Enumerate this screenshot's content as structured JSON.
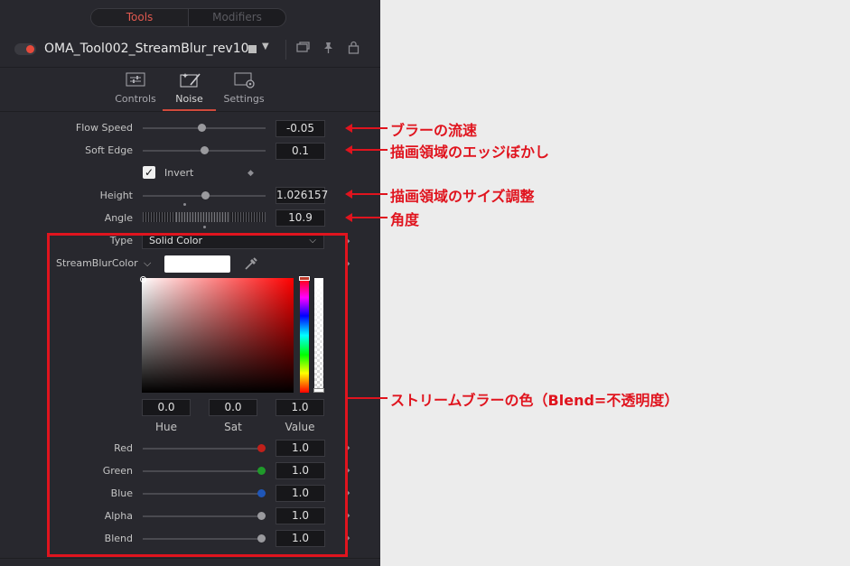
{
  "switcher": {
    "tools": "Tools",
    "modifiers": "Modifiers"
  },
  "header": {
    "tool_name": "OMA_Tool002_StreamBlur_rev10"
  },
  "tabs": [
    {
      "label": "Controls",
      "icon": "sliders-icon"
    },
    {
      "label": "Noise",
      "icon": "wand-icon"
    },
    {
      "label": "Settings",
      "icon": "gear-icon"
    }
  ],
  "params": {
    "flow_speed": {
      "label": "Flow Speed",
      "value": "-0.05"
    },
    "soft_edge": {
      "label": "Soft Edge",
      "value": "0.1"
    },
    "invert": {
      "label": "Invert",
      "checked": true
    },
    "height": {
      "label": "Height",
      "value": "1.026157"
    },
    "angle": {
      "label": "Angle",
      "value": "10.9"
    },
    "type": {
      "label": "Type",
      "value": "Solid Color"
    },
    "color_label": "StreamBlurColor"
  },
  "hsv": {
    "hue": {
      "label": "Hue",
      "value": "0.0"
    },
    "sat": {
      "label": "Sat",
      "value": "0.0"
    },
    "val": {
      "label": "Value",
      "value": "1.0"
    }
  },
  "channels": {
    "red": {
      "label": "Red",
      "value": "1.0",
      "color": "#c0201a"
    },
    "green": {
      "label": "Green",
      "value": "1.0",
      "color": "#1f9a2a"
    },
    "blue": {
      "label": "Blue",
      "value": "1.0",
      "color": "#1f56b8"
    },
    "alpha": {
      "label": "Alpha",
      "value": "1.0",
      "color": "#9a9a9e"
    },
    "blend": {
      "label": "Blend",
      "value": "1.0",
      "color": "#9a9a9e"
    }
  },
  "annotations": {
    "flow_speed": "ブラーの流速",
    "soft_edge": "描画領域のエッジぼかし",
    "height": "描画領域のサイズ調整",
    "angle": "角度",
    "color": "ストリームブラーの色（Blend=不透明度）"
  },
  "colors": {
    "accent": "#d04a3c",
    "annotation": "#e0141e",
    "panel_bg": "#28282e"
  }
}
